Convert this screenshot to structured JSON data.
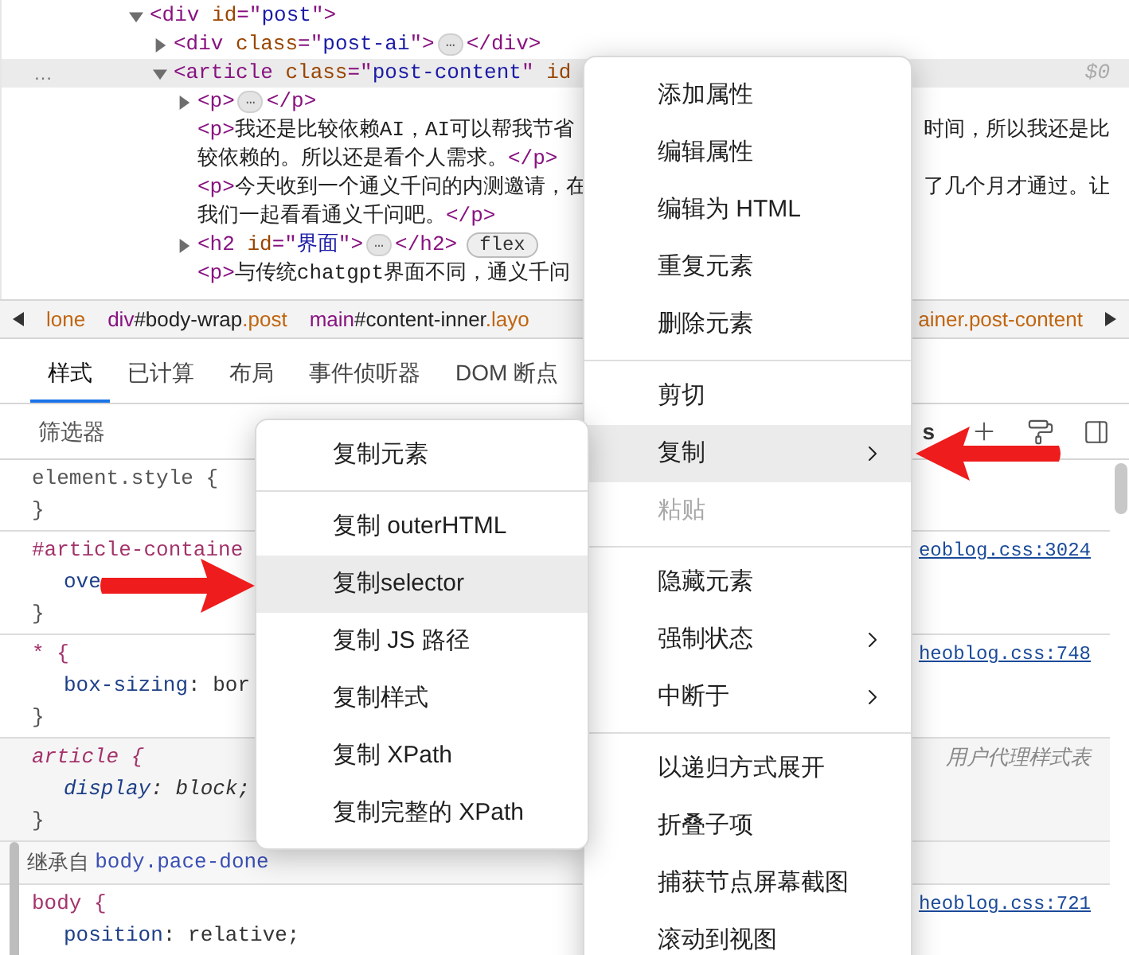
{
  "elements_panel": {
    "row_marker": "…",
    "nodes": [
      {
        "expandable": true,
        "expanded": true,
        "selected": false,
        "lines": [
          {
            "left": [
              {
                "kind": "tag",
                "t": "<div"
              },
              {
                "kind": "attr",
                "t": " id"
              },
              {
                "kind": "tag",
                "t": "=\""
              },
              {
                "kind": "value",
                "t": "post"
              },
              {
                "kind": "tag",
                "t": "\">"
              }
            ]
          }
        ],
        "children": [
          {
            "expandable": true,
            "expanded": false,
            "selected": false,
            "lines": [
              {
                "left": [
                  {
                    "kind": "tag",
                    "t": "<div"
                  },
                  {
                    "kind": "attr",
                    "t": " class"
                  },
                  {
                    "kind": "tag",
                    "t": "=\""
                  },
                  {
                    "kind": "value",
                    "t": "post-ai"
                  },
                  {
                    "kind": "tag",
                    "t": "\">"
                  },
                  {
                    "kind": "ellipsis",
                    "t": "…"
                  },
                  {
                    "kind": "tag",
                    "t": "</div>"
                  }
                ]
              }
            ]
          },
          {
            "expandable": true,
            "expanded": true,
            "selected": true,
            "lines": [
              {
                "left": [
                  {
                    "kind": "tag",
                    "t": "<article"
                  },
                  {
                    "kind": "attr",
                    "t": " class"
                  },
                  {
                    "kind": "tag",
                    "t": "=\""
                  },
                  {
                    "kind": "value",
                    "t": "post-content"
                  },
                  {
                    "kind": "tag",
                    "t": "\""
                  },
                  {
                    "kind": "attr",
                    "t": " id"
                  }
                ],
                "right": [
                  {
                    "kind": "faint",
                    "t": "$0"
                  }
                ]
              }
            ],
            "children": [
              {
                "expandable": true,
                "expanded": false,
                "selected": false,
                "lines": [
                  {
                    "left": [
                      {
                        "kind": "tag",
                        "t": "<p>"
                      },
                      {
                        "kind": "ellipsis",
                        "t": "…"
                      },
                      {
                        "kind": "tag",
                        "t": "</p>"
                      }
                    ]
                  }
                ]
              },
              {
                "expandable": false,
                "selected": false,
                "lines": [
                  {
                    "left": [
                      {
                        "kind": "tag",
                        "t": "<p>"
                      },
                      {
                        "kind": "text",
                        "t": "我还是比较依赖AI，AI可以帮我节省"
                      }
                    ],
                    "right": [
                      {
                        "kind": "text",
                        "t": "时间，所以我还是比"
                      }
                    ]
                  },
                  {
                    "left": [
                      {
                        "kind": "text",
                        "t": "较依赖的。所以还是看个人需求。"
                      },
                      {
                        "kind": "tag",
                        "t": "</p>"
                      }
                    ]
                  }
                ]
              },
              {
                "expandable": false,
                "selected": false,
                "lines": [
                  {
                    "left": [
                      {
                        "kind": "tag",
                        "t": "<p>"
                      },
                      {
                        "kind": "text",
                        "t": "今天收到一个通义千问的内测邀请，在"
                      }
                    ],
                    "right": [
                      {
                        "kind": "text",
                        "t": "了几个月才通过。让"
                      }
                    ]
                  },
                  {
                    "left": [
                      {
                        "kind": "text",
                        "t": "我们一起看看通义千问吧。"
                      },
                      {
                        "kind": "tag",
                        "t": "</p>"
                      }
                    ]
                  }
                ]
              },
              {
                "expandable": true,
                "expanded": false,
                "selected": false,
                "lines": [
                  {
                    "left": [
                      {
                        "kind": "tag",
                        "t": "<h2"
                      },
                      {
                        "kind": "attr",
                        "t": " id"
                      },
                      {
                        "kind": "tag",
                        "t": "=\""
                      },
                      {
                        "kind": "value",
                        "t": "界面"
                      },
                      {
                        "kind": "tag",
                        "t": "\">"
                      },
                      {
                        "kind": "ellipsis",
                        "t": "…"
                      },
                      {
                        "kind": "tag",
                        "t": "</h2>"
                      },
                      {
                        "kind": "badge",
                        "t": "flex"
                      }
                    ]
                  }
                ]
              },
              {
                "expandable": false,
                "selected": false,
                "lines": [
                  {
                    "left": [
                      {
                        "kind": "tag",
                        "t": "<p>"
                      },
                      {
                        "kind": "text",
                        "t": "与传统chatgpt界面不同，通义千问"
                      }
                    ]
                  }
                ]
              }
            ]
          }
        ]
      }
    ]
  },
  "breadcrumb": {
    "left_items": [
      {
        "parts": [
          {
            "kind": "class",
            "t": "lone"
          }
        ]
      },
      {
        "parts": [
          {
            "kind": "tag",
            "t": "div"
          },
          {
            "kind": "id",
            "t": "#body-wrap"
          },
          {
            "kind": "class",
            "t": ".post"
          }
        ]
      },
      {
        "parts": [
          {
            "kind": "tag",
            "t": "main"
          },
          {
            "kind": "id",
            "t": "#content-inner"
          },
          {
            "kind": "class",
            "t": ".layo"
          }
        ]
      }
    ],
    "right_items": [
      {
        "parts": [
          {
            "kind": "class",
            "t": "ainer.post-content"
          }
        ]
      }
    ]
  },
  "tabs": [
    {
      "label": "样式",
      "selected": true
    },
    {
      "label": "已计算",
      "selected": false
    },
    {
      "label": "布局",
      "selected": false
    },
    {
      "label": "事件侦听器",
      "selected": false
    },
    {
      "label": "DOM 断点",
      "selected": false
    }
  ],
  "filter": {
    "placeholder": "筛选器",
    "toolbar_text": "s"
  },
  "styles": [
    {
      "kind": "inline",
      "selector": "element.style {",
      "close": "}"
    },
    {
      "kind": "author",
      "selector": "#article-containe",
      "declarations": [
        {
          "prop": "ove"
        }
      ],
      "close": "}",
      "source": "eoblog.css:3024"
    },
    {
      "kind": "author",
      "selector": "* {",
      "declarations": [
        {
          "prop": "box-sizing",
          "rest": ": bor"
        }
      ],
      "close": "}",
      "source": "heoblog.css:748"
    },
    {
      "kind": "user-agent",
      "selector": "article {",
      "declarations": [
        {
          "prop": "display",
          "rest": ": block;"
        }
      ],
      "close": "}",
      "source": "用户代理样式表"
    },
    {
      "kind": "inherited-header",
      "label": "继承自 ",
      "link": "body.pace-done"
    },
    {
      "kind": "author",
      "selector": "body {",
      "declarations": [
        {
          "prop": "position",
          "rest": ": relative;"
        }
      ],
      "source": "heoblog.css:721"
    }
  ],
  "context_menu": {
    "items": [
      {
        "kind": "item",
        "label": "添加属性",
        "selected": false,
        "disabled": false,
        "submenu": false
      },
      {
        "kind": "item",
        "label": "编辑属性",
        "selected": false,
        "disabled": false,
        "submenu": false
      },
      {
        "kind": "item",
        "label": "编辑为 HTML",
        "selected": false,
        "disabled": false,
        "submenu": false
      },
      {
        "kind": "item",
        "label": "重复元素",
        "selected": false,
        "disabled": false,
        "submenu": false
      },
      {
        "kind": "item",
        "label": "删除元素",
        "selected": false,
        "disabled": false,
        "submenu": false
      },
      {
        "kind": "separator"
      },
      {
        "kind": "item",
        "label": "剪切",
        "selected": false,
        "disabled": false,
        "submenu": false
      },
      {
        "kind": "item",
        "label": "复制",
        "selected": true,
        "disabled": false,
        "submenu": true
      },
      {
        "kind": "item",
        "label": "粘贴",
        "selected": false,
        "disabled": true,
        "submenu": false
      },
      {
        "kind": "separator"
      },
      {
        "kind": "item",
        "label": "隐藏元素",
        "selected": false,
        "disabled": false,
        "submenu": false
      },
      {
        "kind": "item",
        "label": "强制状态",
        "selected": false,
        "disabled": false,
        "submenu": true
      },
      {
        "kind": "item",
        "label": "中断于",
        "selected": false,
        "disabled": false,
        "submenu": true
      },
      {
        "kind": "separator"
      },
      {
        "kind": "item",
        "label": "以递归方式展开",
        "selected": false,
        "disabled": false,
        "submenu": false
      },
      {
        "kind": "item",
        "label": "折叠子项",
        "selected": false,
        "disabled": false,
        "submenu": false
      },
      {
        "kind": "item",
        "label": "捕获节点屏幕截图",
        "selected": false,
        "disabled": false,
        "submenu": false
      },
      {
        "kind": "item",
        "label": "滚动到视图",
        "selected": false,
        "disabled": false,
        "submenu": false
      }
    ]
  },
  "copy_submenu": {
    "items": [
      {
        "kind": "item",
        "label": "复制元素",
        "selected": false,
        "disabled": false,
        "submenu": false
      },
      {
        "kind": "separator"
      },
      {
        "kind": "item",
        "label": "复制 outerHTML",
        "selected": false,
        "disabled": false,
        "submenu": false
      },
      {
        "kind": "item",
        "label": "复制selector",
        "selected": true,
        "disabled": false,
        "submenu": false
      },
      {
        "kind": "item",
        "label": "复制 JS 路径",
        "selected": false,
        "disabled": false,
        "submenu": false
      },
      {
        "kind": "item",
        "label": "复制样式",
        "selected": false,
        "disabled": false,
        "submenu": false
      },
      {
        "kind": "item",
        "label": "复制 XPath",
        "selected": false,
        "disabled": false,
        "submenu": false
      },
      {
        "kind": "item",
        "label": "复制完整的 XPath",
        "selected": false,
        "disabled": false,
        "submenu": false
      }
    ]
  }
}
